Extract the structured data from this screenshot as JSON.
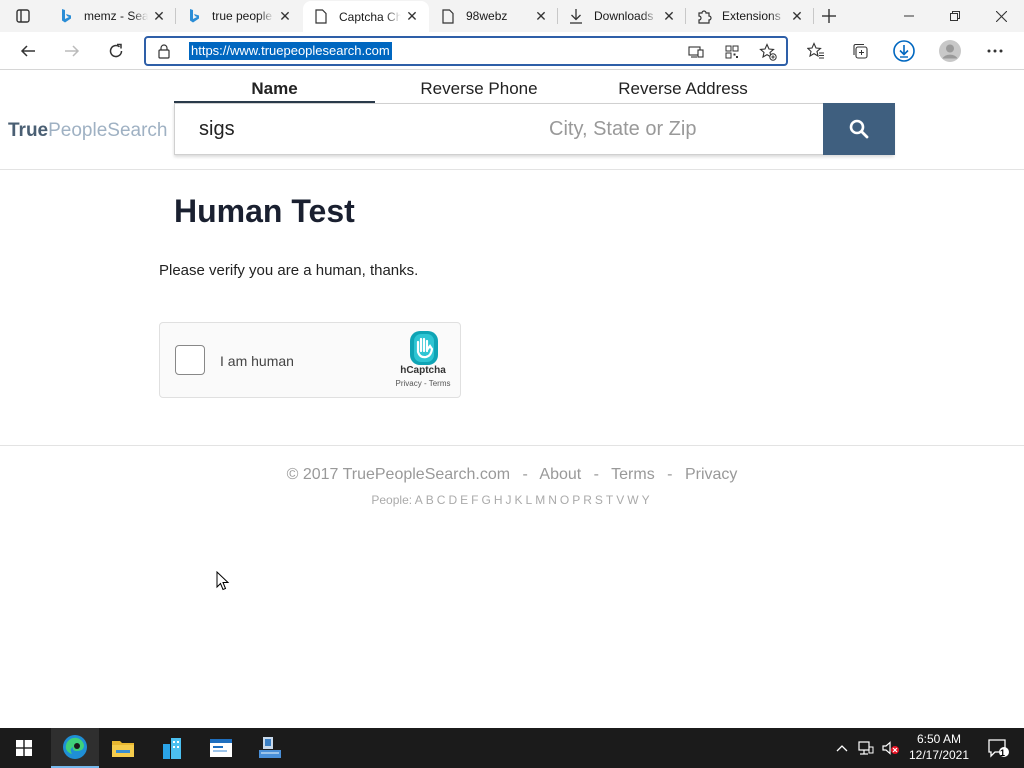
{
  "browser": {
    "tabs": [
      {
        "title": "memz - Search",
        "icon": "bing-icon"
      },
      {
        "title": "true people search",
        "icon": "bing-icon"
      },
      {
        "title": "Captcha Challenge",
        "icon": "page-icon"
      },
      {
        "title": "98webz",
        "icon": "page-icon"
      },
      {
        "title": "Downloads",
        "icon": "download-icon"
      },
      {
        "title": "Extensions",
        "icon": "puzzle-icon"
      }
    ],
    "url": "https://www.truepeoplesearch.com",
    "accent": "#0067c0"
  },
  "site": {
    "logo_bold": "True",
    "logo_light": "PeopleSearch",
    "search_tabs": [
      "Name",
      "Reverse Phone",
      "Reverse Address"
    ],
    "name_value": "sigs",
    "location_placeholder": "City, State or Zip",
    "search_button_color": "#3f5f7f"
  },
  "main": {
    "title": "Human Test",
    "subtitle": "Please verify you are a human, thanks."
  },
  "captcha": {
    "label": "I am human",
    "brand": "hCaptcha",
    "links": "Privacy - Terms"
  },
  "footer": {
    "copyright": "© 2017 TruePeopleSearch.com",
    "sep": "-",
    "about": "About",
    "terms": "Terms",
    "privacy": "Privacy",
    "people_label": "People:",
    "letters": [
      "A",
      "B",
      "C",
      "D",
      "E",
      "F",
      "G",
      "H",
      "J",
      "K",
      "L",
      "M",
      "N",
      "O",
      "P",
      "R",
      "S",
      "T",
      "V",
      "W",
      "Y"
    ]
  },
  "taskbar": {
    "time": "6:50 AM",
    "date": "12/17/2021",
    "notification_count": "1"
  }
}
